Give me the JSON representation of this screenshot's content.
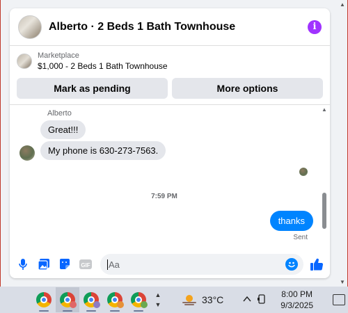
{
  "header": {
    "title": "Alberto · 2 Beds 1 Bath Townhouse",
    "info_icon": "info-icon",
    "accent": "#a033ff"
  },
  "listing": {
    "label": "Marketplace",
    "price_title": "$1,000 - 2 Beds 1 Bath Townhouse"
  },
  "actions": {
    "pending_label": "Mark as pending",
    "more_label": "More options"
  },
  "messages": {
    "sender": "Alberto",
    "incoming": [
      {
        "text": "Great!!!"
      },
      {
        "text": "My phone is 630-273-7563."
      }
    ],
    "timestamp": "7:59 PM",
    "outgoing": {
      "text": "thanks",
      "color": "#0084ff"
    },
    "status": "Sent"
  },
  "composer": {
    "placeholder": "Aa",
    "icons": [
      "microphone-icon",
      "photo-icon",
      "sticker-icon",
      "gif-icon",
      "emoji-icon",
      "thumbs-up-icon"
    ],
    "gif_label": "GIF"
  },
  "taskbar": {
    "apps": [
      "chrome-icon",
      "chrome-icon",
      "chrome-icon",
      "chrome-icon",
      "chrome-icon"
    ],
    "temperature": "33°C",
    "time": "8:00 PM",
    "date": "9/3/2025"
  }
}
